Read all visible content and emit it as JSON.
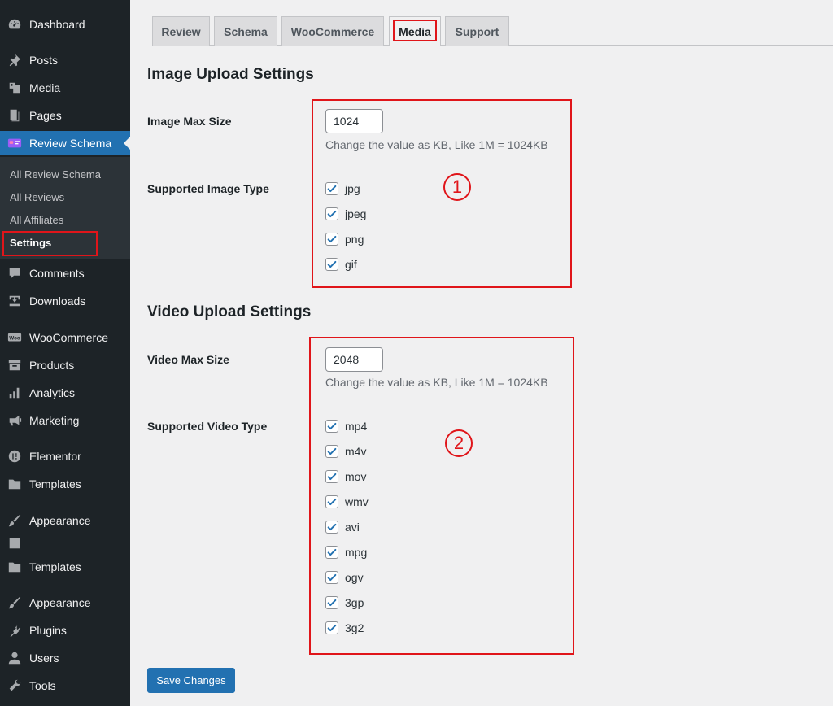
{
  "sidebar": {
    "menu": [
      {
        "label": "Dashboard",
        "icon": "dashboard-icon"
      },
      {
        "label": "Posts",
        "icon": "pin-icon"
      },
      {
        "label": "Media",
        "icon": "media-icon"
      },
      {
        "label": "Pages",
        "icon": "pages-icon"
      },
      {
        "label": "Review Schema",
        "icon": "review-schema-icon"
      },
      {
        "label": "Comments",
        "icon": "comment-icon"
      },
      {
        "label": "Downloads",
        "icon": "download-icon"
      },
      {
        "label": "WooCommerce",
        "icon": "woocommerce-icon"
      },
      {
        "label": "Products",
        "icon": "archive-icon"
      },
      {
        "label": "Analytics",
        "icon": "bar-chart-icon"
      },
      {
        "label": "Marketing",
        "icon": "megaphone-icon"
      },
      {
        "label": "Elementor",
        "icon": "elementor-icon"
      },
      {
        "label": "Templates",
        "icon": "folder-icon"
      },
      {
        "label": "Appearance",
        "icon": "paintbrush-icon"
      },
      {
        "label": "Templates",
        "icon": "folder-icon"
      },
      {
        "label": "Appearance",
        "icon": "paintbrush-icon"
      },
      {
        "label": "Plugins",
        "icon": "plugin-icon"
      },
      {
        "label": "Users",
        "icon": "user-icon"
      },
      {
        "label": "Tools",
        "icon": "wrench-icon"
      }
    ],
    "submenu": [
      {
        "label": "All Review Schema"
      },
      {
        "label": "All Reviews"
      },
      {
        "label": "All Affiliates"
      },
      {
        "label": "Settings"
      }
    ]
  },
  "tabs": [
    {
      "label": "Review"
    },
    {
      "label": "Schema"
    },
    {
      "label": "WooCommerce"
    },
    {
      "label": "Media"
    },
    {
      "label": "Support"
    }
  ],
  "image_section": {
    "title": "Image Upload Settings",
    "max_size_label": "Image Max Size",
    "max_size_value": "1024",
    "help": "Change the value as KB, Like 1M = 1024KB",
    "types_label": "Supported Image Type",
    "types": [
      "jpg",
      "jpeg",
      "png",
      "gif"
    ],
    "annotation": "1"
  },
  "video_section": {
    "title": "Video Upload Settings",
    "max_size_label": "Video Max Size",
    "max_size_value": "2048",
    "help": "Change the value as KB, Like 1M = 1024KB",
    "types_label": "Supported Video Type",
    "types": [
      "mp4",
      "m4v",
      "mov",
      "wmv",
      "avi",
      "mpg",
      "ogv",
      "3gp",
      "3g2"
    ],
    "annotation": "2"
  },
  "save_label": "Save Changes",
  "colors": {
    "accent": "#2271b1",
    "annotation": "#e0151a",
    "sidebar": "#1d2327"
  }
}
